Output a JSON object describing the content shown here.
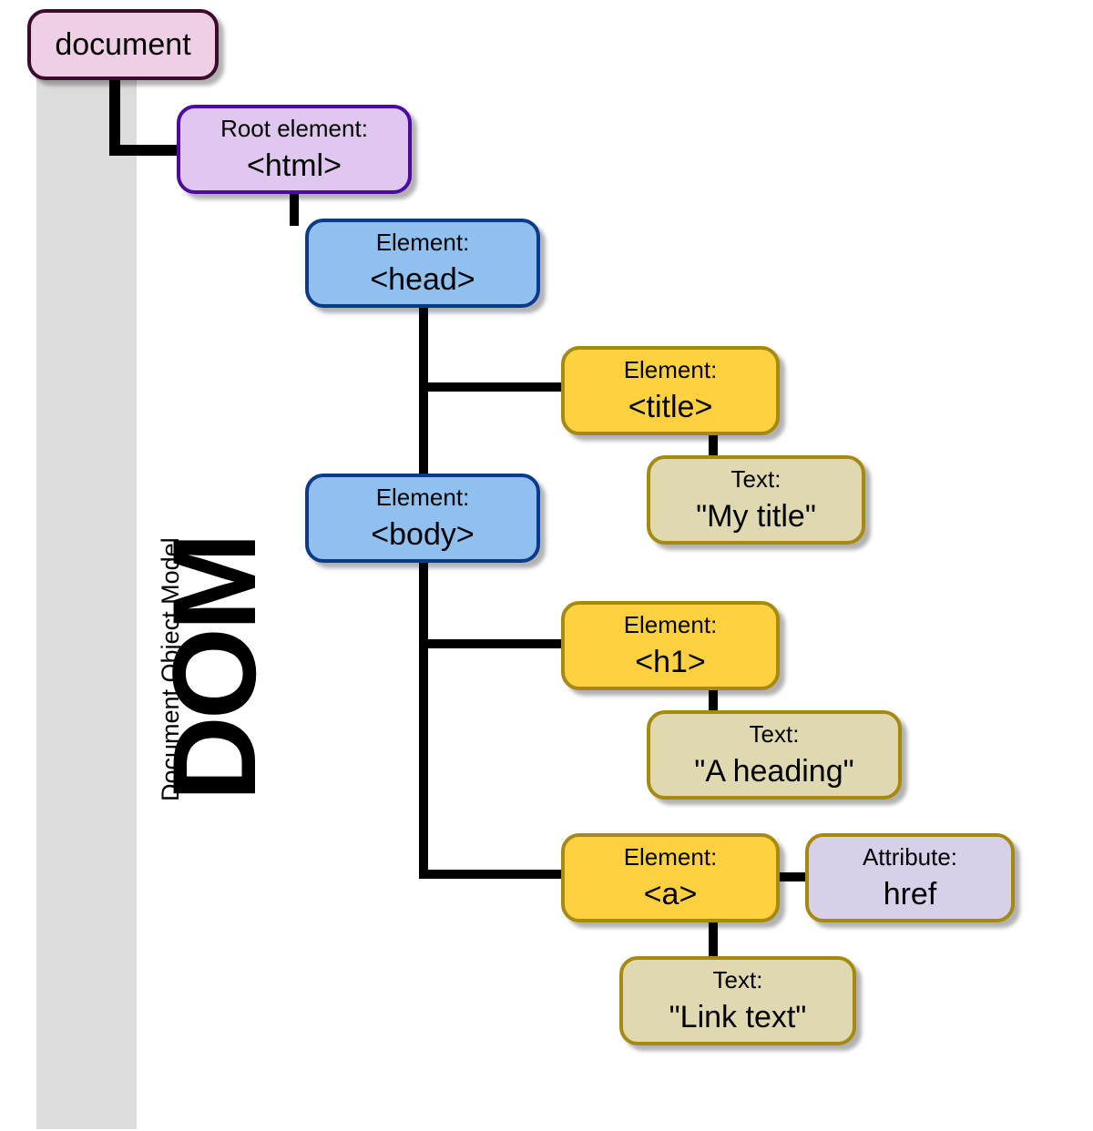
{
  "sidebar": {
    "acronym": "DOM",
    "expansion": "Document Object Model"
  },
  "nodes": {
    "document": {
      "label": "document"
    },
    "html": {
      "type": "Root element:",
      "tag": "<html>"
    },
    "head": {
      "type": "Element:",
      "tag": "<head>"
    },
    "title": {
      "type": "Element:",
      "tag": "<title>"
    },
    "title_text": {
      "type": "Text:",
      "value": "\"My title\""
    },
    "body": {
      "type": "Element:",
      "tag": "<body>"
    },
    "h1": {
      "type": "Element:",
      "tag": "<h1>"
    },
    "h1_text": {
      "type": "Text:",
      "value": "\"A heading\""
    },
    "a": {
      "type": "Element:",
      "tag": "<a>"
    },
    "a_attr": {
      "type": "Attribute:",
      "value": "href"
    },
    "a_text": {
      "type": "Text:",
      "value": "\"Link text\""
    }
  }
}
